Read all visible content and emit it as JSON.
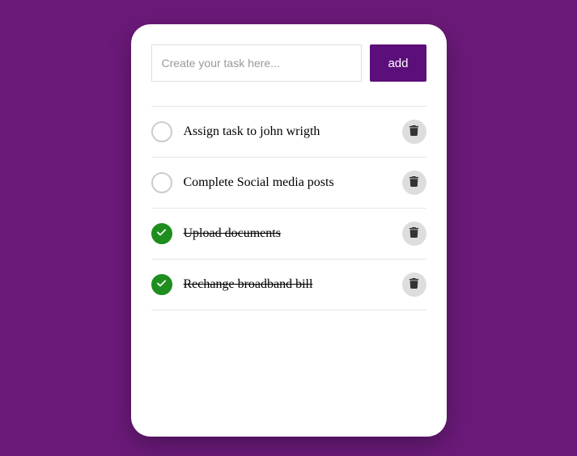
{
  "input": {
    "placeholder": "Create your task here...",
    "value": ""
  },
  "add_button_label": "add",
  "tasks": [
    {
      "label": "Assign task to john wrigth",
      "done": false
    },
    {
      "label": "Complete Social media posts",
      "done": false
    },
    {
      "label": "Upload documents",
      "done": true
    },
    {
      "label": "Rechange broadband bill",
      "done": true
    }
  ]
}
